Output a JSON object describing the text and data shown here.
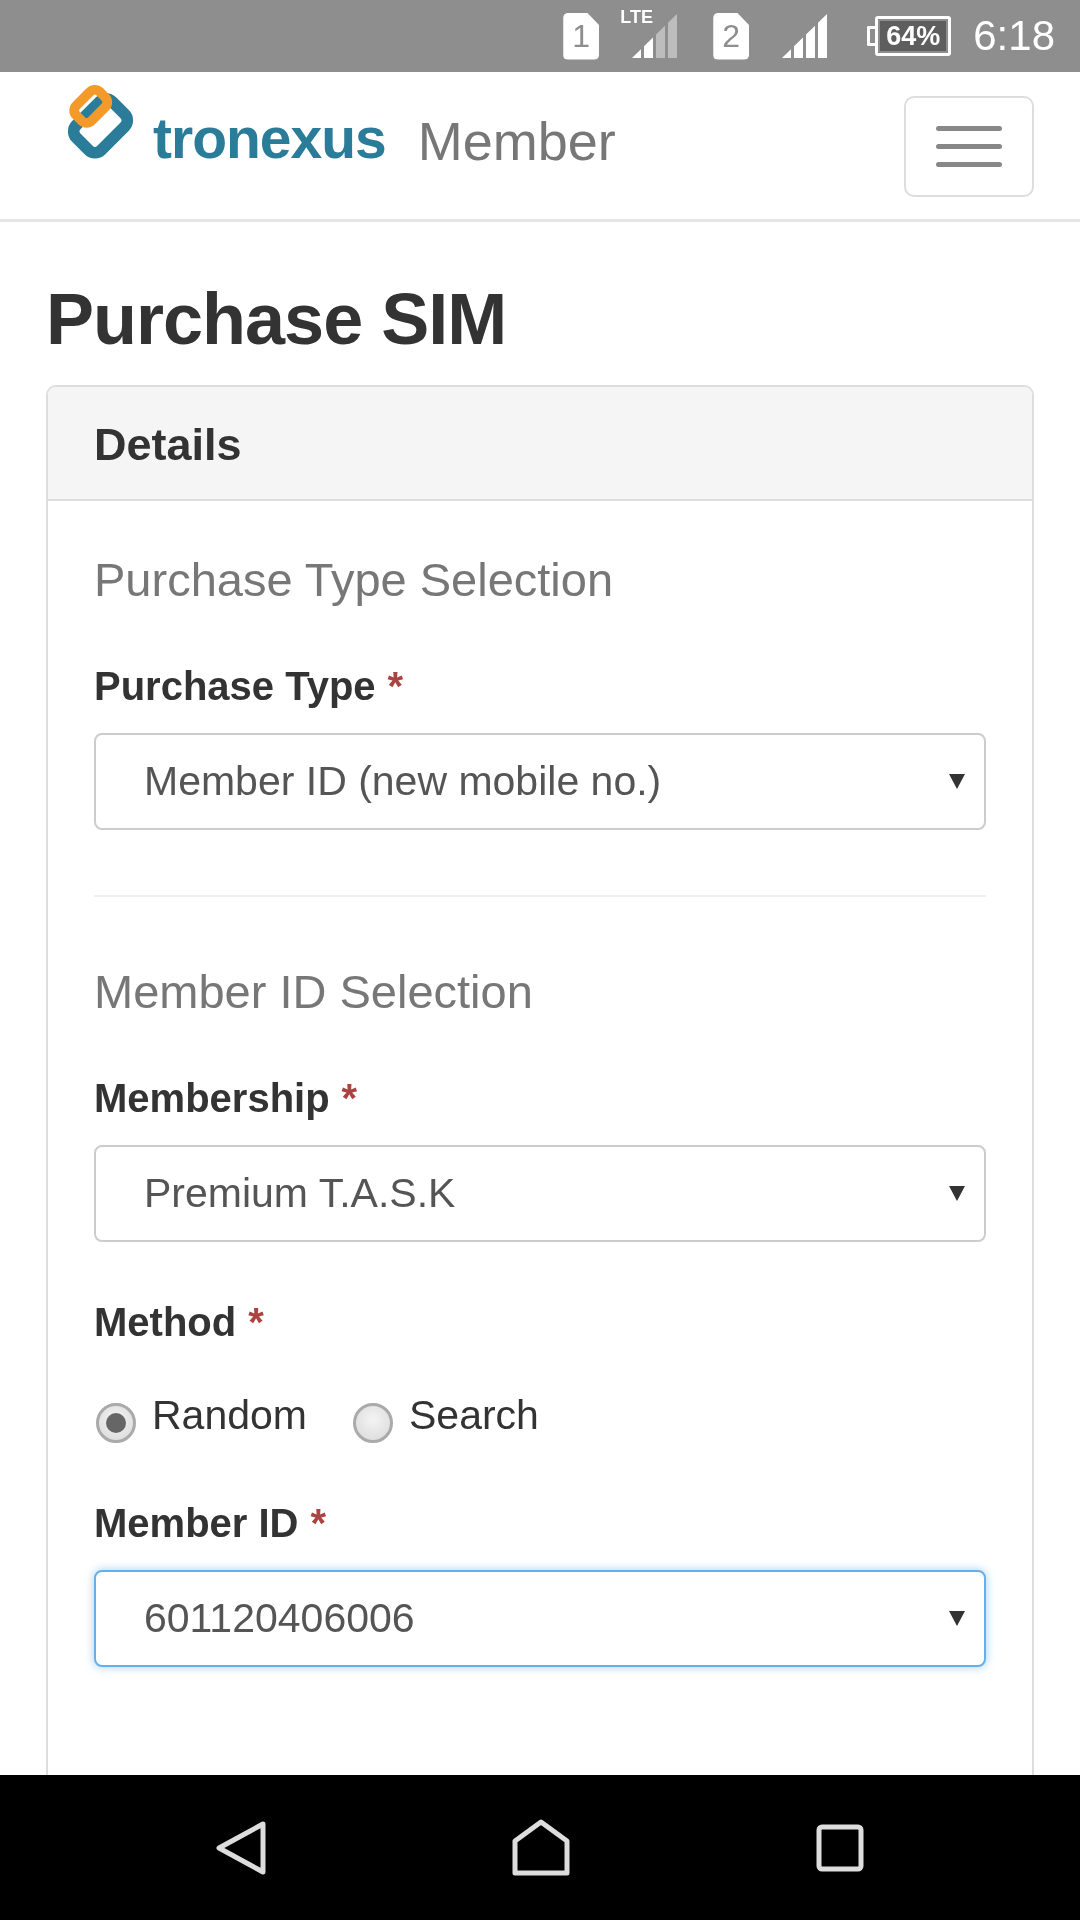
{
  "status_bar": {
    "sims": [
      {
        "label": "1",
        "network_type": "LTE"
      },
      {
        "label": "2"
      }
    ],
    "battery": "64%",
    "time": "6:18"
  },
  "navbar": {
    "brand": "tronexus",
    "title": "Member"
  },
  "page_title": "Purchase SIM",
  "card": {
    "title": "Details",
    "sections": [
      {
        "title": "Purchase Type Selection",
        "fields": [
          {
            "kind": "select",
            "label": "Purchase Type",
            "required_mark": "*",
            "value": "Member ID (new mobile no.)",
            "focused": false
          }
        ]
      },
      {
        "title": "Member ID Selection",
        "fields": [
          {
            "kind": "select",
            "label": "Membership",
            "required_mark": "*",
            "value": "Premium T.A.S.K",
            "focused": false
          },
          {
            "kind": "radio",
            "label": "Method",
            "required_mark": "*",
            "options": [
              {
                "label": "Random",
                "selected": true
              },
              {
                "label": "Search",
                "selected": false
              }
            ]
          },
          {
            "kind": "select",
            "label": "Member ID",
            "required_mark": "*",
            "value": "601120406006",
            "focused": true
          }
        ]
      }
    ]
  }
}
